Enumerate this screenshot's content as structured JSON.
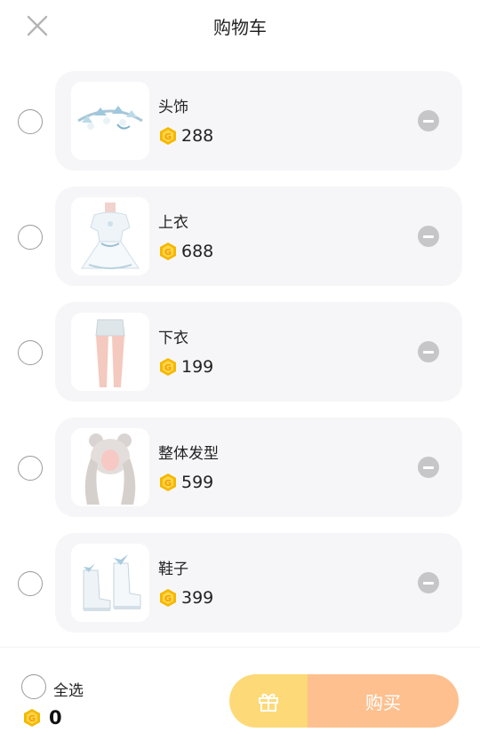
{
  "header": {
    "title": "购物车"
  },
  "items": [
    {
      "name": "头饰",
      "price": "288"
    },
    {
      "name": "上衣",
      "price": "688"
    },
    {
      "name": "下衣",
      "price": "199"
    },
    {
      "name": "整体发型",
      "price": "599"
    },
    {
      "name": "鞋子",
      "price": "399"
    }
  ],
  "footer": {
    "select_all_label": "全选",
    "total": "0",
    "buy_label": "购买"
  },
  "colors": {
    "coin": "#f5b800",
    "gift_button": "#fdd978",
    "buy_button": "#fec08f",
    "card_bg": "#f6f6f8"
  }
}
